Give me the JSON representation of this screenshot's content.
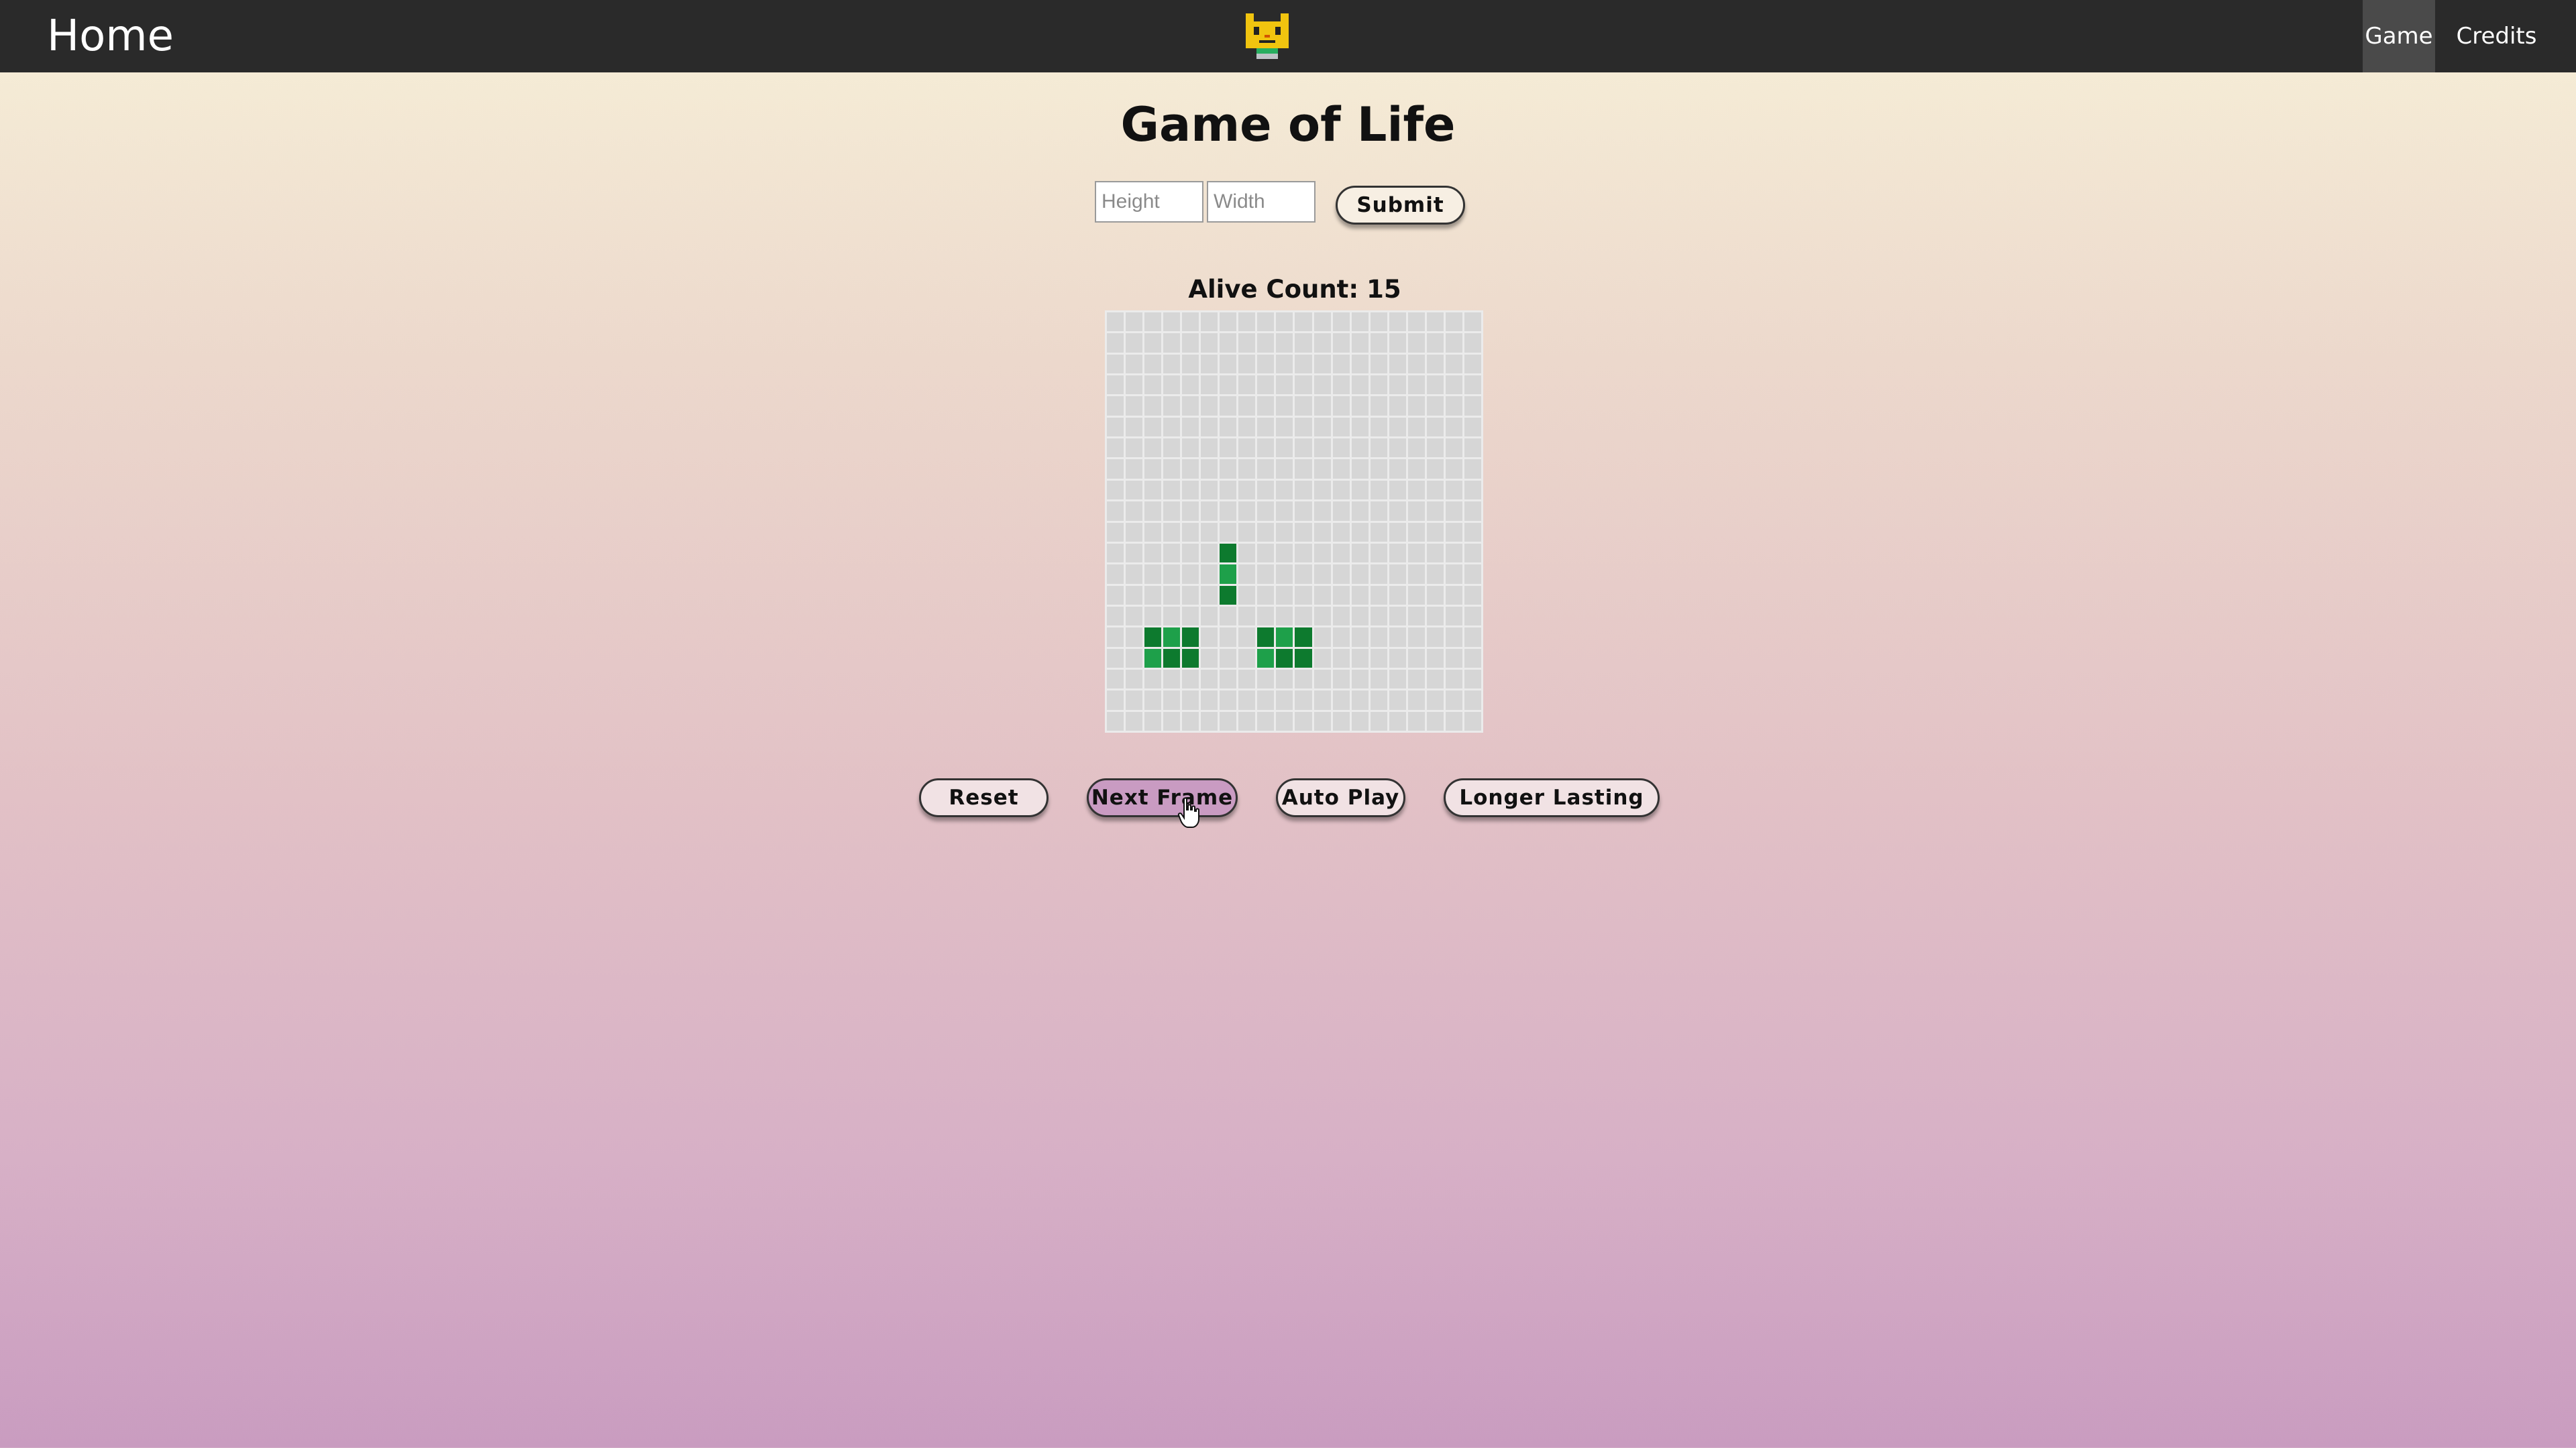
{
  "nav": {
    "home": "Home",
    "items": [
      {
        "label": "Game",
        "active": true
      },
      {
        "label": "Credits",
        "active": false
      }
    ],
    "logo_icon": "cat-icon"
  },
  "page": {
    "title": "Game of Life"
  },
  "form": {
    "height_placeholder": "Height",
    "width_placeholder": "Width",
    "height_value": "",
    "width_value": "",
    "submit_label": "Submit"
  },
  "status": {
    "alive_label": "Alive Count:",
    "alive_count": "15"
  },
  "board": {
    "rows": 20,
    "cols": 20,
    "alive_color": "#0d7a2e",
    "dead_color": "#d6d6d6",
    "alive_cells": [
      [
        11,
        6
      ],
      [
        12,
        6
      ],
      [
        13,
        6
      ],
      [
        15,
        2
      ],
      [
        15,
        3
      ],
      [
        15,
        4
      ],
      [
        16,
        2
      ],
      [
        16,
        3
      ],
      [
        16,
        4
      ],
      [
        15,
        8
      ],
      [
        15,
        9
      ],
      [
        15,
        10
      ],
      [
        16,
        8
      ],
      [
        16,
        9
      ],
      [
        16,
        10
      ]
    ]
  },
  "controls": {
    "reset": "Reset",
    "next_frame": "Next Frame",
    "auto_play": "Auto Play",
    "longer_lasting": "Longer Lasting"
  },
  "colors": {
    "nav_bg": "#2a2a2a",
    "active_nav_bg": "#4a4a4a",
    "button_bg": "#f1e2e4",
    "hover_button_bg": "#c99bc2"
  }
}
